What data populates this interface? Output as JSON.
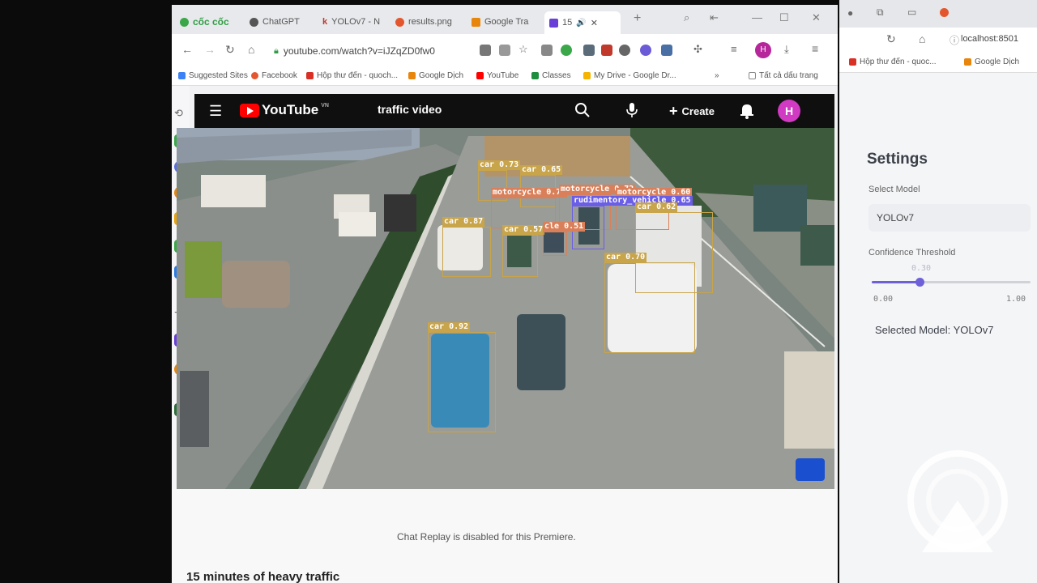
{
  "browser": {
    "tabs": [
      {
        "label": "cốc cốc",
        "icon": "coccoc-logo-icon"
      },
      {
        "label": "ChatGPT",
        "icon": "chatgpt-icon"
      },
      {
        "label": "YOLOv7 - N",
        "icon": "k-icon"
      },
      {
        "label": "results.png",
        "icon": "image-icon"
      },
      {
        "label": "Google Tra",
        "icon": "google-translate-icon"
      },
      {
        "label": "15",
        "icon": "youtube-icon"
      }
    ],
    "url": "youtube.com/watch?v=iJZqZD0fw0",
    "bookmarks": [
      {
        "label": "Suggested Sites",
        "color": "#3b82f6"
      },
      {
        "label": "Facebook",
        "color": "#e4572e"
      },
      {
        "label": "Hộp thư đến - quoch...",
        "color": "#d93025"
      },
      {
        "label": "Google Dịch",
        "color": "#e8860b"
      },
      {
        "label": "YouTube",
        "color": "#ff0000"
      },
      {
        "label": "Classes",
        "color": "#1e8e3e"
      },
      {
        "label": "My Drive - Google Dr...",
        "color": "#f4b400"
      },
      {
        "label": "Tất cả dấu trang",
        "color": "#888888"
      }
    ],
    "profile_initial": "H"
  },
  "youtube": {
    "logo_text": "YouTube",
    "logo_region": "VN",
    "search_query": "traffic video",
    "create_label": "Create",
    "avatar_initial": "H",
    "chat_replay": "Chat Replay is disabled for this Premiere.",
    "video_title": "15 minutes of heavy traffic"
  },
  "detections": [
    {
      "label": "car 0.73",
      "color": "#c8a44a"
    },
    {
      "label": "car 0.65",
      "color": "#c8a44a"
    },
    {
      "label": "motorcycle 0.73",
      "color": "#d9805a"
    },
    {
      "label": "motorcycle 0.72",
      "color": "#d9805a"
    },
    {
      "label": "motorcycle 0.60",
      "color": "#d9805a"
    },
    {
      "label": "rudimentory_vehicle 0.65",
      "color": "#6a5de6"
    },
    {
      "label": "car 0.62",
      "color": "#c8a44a"
    },
    {
      "label": "car 0.87",
      "color": "#c8a44a"
    },
    {
      "label": "car 0.57",
      "color": "#c8a44a"
    },
    {
      "label": "cle 0.51",
      "color": "#d9805a"
    },
    {
      "label": "car 0.70",
      "color": "#c8a44a"
    },
    {
      "label": "car 0.92",
      "color": "#c8a44a"
    }
  ],
  "right_app": {
    "url": "localhost:8501",
    "bookmarks": [
      {
        "label": "Hộp thư đến - quoc...",
        "color": "#d93025"
      },
      {
        "label": "Google Dịch",
        "color": "#e8860b"
      }
    ],
    "settings_title": "Settings",
    "select_model_label": "Select Model",
    "model_value": "YOLOv7",
    "confidence_label": "Confidence Threshold",
    "confidence_value": "0.30",
    "confidence_fraction": 0.3,
    "confidence_min": "0.00",
    "confidence_max": "1.00",
    "selected_model_text": "Selected Model: YOLOv7"
  }
}
